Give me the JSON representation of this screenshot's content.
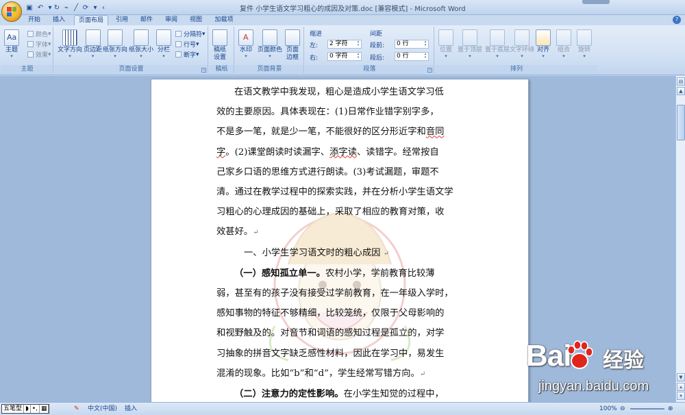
{
  "window": {
    "title": "复件 小学生语文学习粗心的成因及对策.doc [兼容模式] - Microsoft Word"
  },
  "tabs": [
    {
      "label": "开始",
      "active": false
    },
    {
      "label": "插入",
      "active": false
    },
    {
      "label": "页面布局",
      "active": true
    },
    {
      "label": "引用",
      "active": false
    },
    {
      "label": "邮件",
      "active": false
    },
    {
      "label": "审阅",
      "active": false
    },
    {
      "label": "视图",
      "active": false
    },
    {
      "label": "加载项",
      "active": false
    }
  ],
  "ribbon": {
    "theme": {
      "label": "主题",
      "big_button": "主题",
      "color": "颜色",
      "font": "字体",
      "effect": "效果"
    },
    "page_setup": {
      "label": "页面设置",
      "text_direction": "文字方向",
      "margins": "页边距",
      "orientation": "纸张方向",
      "size": "纸张大小",
      "columns": "分栏",
      "breaks": "分隔符",
      "line_numbers": "行号",
      "hyphenation": "断字"
    },
    "draft": {
      "label": "稿纸",
      "button": "稿纸",
      "button_line2": "设置"
    },
    "page_background": {
      "label": "页面背景",
      "watermark": "水印",
      "page_color": "页面颜色",
      "page_borders": "页面",
      "page_borders_line2": "边框"
    },
    "paragraph": {
      "label": "段落",
      "indent_title": "缩进",
      "left_label": "左:",
      "left_value": "2 字符",
      "right_label": "右:",
      "right_value": "0 字符",
      "spacing_title": "间距",
      "before_label": "段前:",
      "before_value": "0 行",
      "after_label": "段后:",
      "after_value": "0 行"
    },
    "arrange": {
      "label": "排列",
      "position": "位置",
      "bring_front": "置于顶层",
      "send_back": "置于底层",
      "text_wrap": "文字环绕",
      "align": "对齐",
      "group": "组合",
      "rotate": "旋转"
    }
  },
  "document": {
    "p1": [
      "在语文教学中我发现，粗心是造成小学生语文学习低",
      "效的主要原因。具体表现在：(1)日常作业错字别字多，",
      "不是多一笔，就是少一笔，不能很好的区分形近字和",
      "音同",
      "字",
      "。(2)课堂朗读时读漏字、",
      "添字读",
      "、读错字。经常按自",
      "己家乡口语的思维方式进行朗读。(3)考试漏题，审题不",
      "清。通过在教学过程中的探索实践，并在分析小学生语文学",
      "习粗心的心理成因的基础上，采取了相应的教育对策，收",
      "效甚好。"
    ],
    "h1": "一、小学生学习语文时的粗心成因",
    "p2_bold": "（一）感知孤立单一。",
    "p2": [
      "农村小学，学前教育比较薄",
      "弱，甚至有的孩子没有接受过学前教育，在一年级入学时，",
      "感知事物的特征不够精细，比较笼统，仅限于父母影响的",
      "和视野触及的。对音节和词语的感知过程是孤立的，对学",
      "习抽象的拼音文字缺乏感性材料，因此在学习中，易发生",
      "混淆的现象。比如“b”和“d”，学生经常写错方向。"
    ],
    "p3_bold": "（二）注意力的定性影响。",
    "p3": "在小学生知觉的过程中，",
    "para_mark": "↵"
  },
  "status": {
    "ime": [
      "五笔型",
      "◗",
      "•,",
      "▦"
    ],
    "language": "中文(中国)",
    "mode": "插入",
    "zoom": "100%"
  },
  "watermark_logo": {
    "brand": "Bai",
    "brand2": "经验",
    "url": "jingyan.baidu.com"
  },
  "colors": {
    "ribbon_bg": "#cfdff3",
    "doc_bg": "#9fb9db",
    "text_blue": "#15428b"
  }
}
